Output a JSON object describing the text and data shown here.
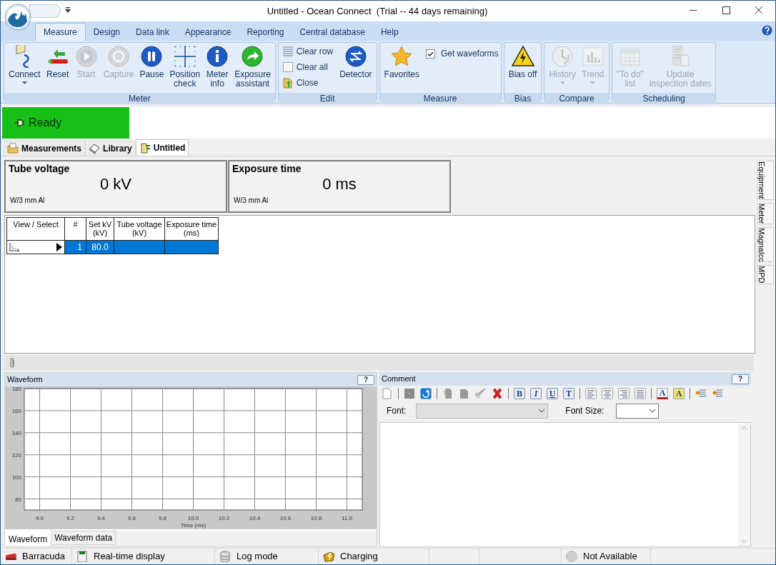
{
  "window": {
    "title": "Untitled - Ocean Connect  (Trial -- 44 days remaining)"
  },
  "ribbon_tabs": [
    {
      "label": "Measure",
      "selected": true
    },
    {
      "label": "Design",
      "selected": false
    },
    {
      "label": "Data link",
      "selected": false
    },
    {
      "label": "Appearance",
      "selected": false
    },
    {
      "label": "Reporting",
      "selected": false
    },
    {
      "label": "Central database",
      "selected": false
    },
    {
      "label": "Help",
      "selected": false
    }
  ],
  "ribbon_groups": [
    {
      "label": "Meter",
      "items": [
        {
          "kind": "large",
          "label": "Connect",
          "disabled": false,
          "dropdown": true
        },
        {
          "kind": "large",
          "label": "Reset",
          "disabled": false,
          "dropdown": false
        },
        {
          "kind": "large",
          "label": "Start",
          "disabled": true,
          "dropdown": false
        },
        {
          "kind": "large",
          "label": "Capture",
          "disabled": true,
          "dropdown": false
        },
        {
          "kind": "large",
          "label": "Pause",
          "disabled": false,
          "dropdown": false
        },
        {
          "kind": "large",
          "label": "Position\ncheck",
          "disabled": false,
          "dropdown": false
        },
        {
          "kind": "large",
          "label": "Meter\ninfo",
          "disabled": false,
          "dropdown": false
        },
        {
          "kind": "large",
          "label": "Exposure\nassistant",
          "disabled": false,
          "dropdown": false
        }
      ]
    },
    {
      "label": "Edit",
      "items": [
        {
          "kind": "small",
          "label": "Clear row",
          "disabled": false
        },
        {
          "kind": "small",
          "label": "Clear all",
          "disabled": false
        },
        {
          "kind": "small",
          "label": "Close",
          "disabled": false
        },
        {
          "kind": "large",
          "label": "Detector",
          "disabled": false,
          "dropdown": false
        }
      ]
    },
    {
      "label": "Measure",
      "items": [
        {
          "kind": "large",
          "label": "Favorites",
          "disabled": false,
          "dropdown": false
        },
        {
          "kind": "check",
          "label": "Get waveforms",
          "checked": true
        }
      ]
    },
    {
      "label": "Bias",
      "items": [
        {
          "kind": "large",
          "label": "Bias off",
          "disabled": false,
          "dropdown": false
        }
      ]
    },
    {
      "label": "Compare",
      "items": [
        {
          "kind": "large",
          "label": "History",
          "disabled": true,
          "dropdown": true
        },
        {
          "kind": "large",
          "label": "Trend",
          "disabled": true,
          "dropdown": true
        }
      ]
    },
    {
      "label": "Scheduling",
      "items": [
        {
          "kind": "large",
          "label": "\"To do\"\nlist",
          "disabled": true,
          "dropdown": false
        },
        {
          "kind": "large",
          "label": "Update\ninspection dates",
          "disabled": true,
          "dropdown": false
        }
      ]
    }
  ],
  "status": {
    "label": "Ready"
  },
  "doc_tabs": [
    {
      "label": "Measurements",
      "selected": false
    },
    {
      "label": "Library",
      "selected": false
    },
    {
      "label": "Untitled",
      "selected": true
    }
  ],
  "meter_cards": [
    {
      "title": "Tube voltage",
      "value": "0 kV",
      "note": "W/3 mm Al"
    },
    {
      "title": "Exposure time",
      "value": "0 ms",
      "note": "W/3 mm Al"
    }
  ],
  "table": {
    "columns": [
      "View / Select",
      "#",
      "Set kV\n(kV)",
      "Tube voltage\n(kV)",
      "Exposure time\n(ms)"
    ],
    "rows": [
      {
        "selected": true,
        "number": "1",
        "set_kv": "80.0"
      }
    ]
  },
  "side_tabs": [
    "Equipment",
    "Meter",
    "MagnaIcc",
    "MPD"
  ],
  "waveform": {
    "title": "Waveform",
    "help": "?",
    "chart_data": {
      "type": "line",
      "xlabel": "Time (ms)",
      "xlim": [
        8.9,
        11.1
      ],
      "ylim": [
        70,
        180
      ],
      "xticks": [
        {
          "value": 9,
          "label": "9.0"
        },
        9.2,
        9.4,
        9.6,
        9.8,
        {
          "value": 10,
          "label": "10.0"
        },
        10.2,
        10.4,
        10.6,
        10.8,
        {
          "value": 11,
          "label": "11.0"
        }
      ],
      "yticks": [
        80,
        100,
        120,
        140,
        160,
        180
      ],
      "grid": true
    },
    "tabs": [
      {
        "label": "Waveform",
        "selected": true
      },
      {
        "label": "Waveform data",
        "selected": false
      }
    ]
  },
  "comment": {
    "title": "Comment",
    "help": "?",
    "toolbar": [
      {
        "kind": "new"
      },
      {
        "kind": "sep"
      },
      {
        "kind": "save"
      },
      {
        "kind": "redo"
      },
      {
        "kind": "sep"
      },
      {
        "kind": "copy"
      },
      {
        "kind": "paste"
      },
      {
        "kind": "cut"
      },
      {
        "kind": "delete"
      },
      {
        "kind": "sep"
      },
      {
        "kind": "letter",
        "label": "B"
      },
      {
        "kind": "letter",
        "label": "I"
      },
      {
        "kind": "letter",
        "label": "U"
      },
      {
        "kind": "letter",
        "label": "T"
      },
      {
        "kind": "sep"
      },
      {
        "kind": "align-left"
      },
      {
        "kind": "align-center"
      },
      {
        "kind": "align-right"
      },
      {
        "kind": "justify"
      },
      {
        "kind": "sep"
      },
      {
        "kind": "color-letter",
        "label": "A"
      },
      {
        "kind": "highlight-letter",
        "label": "A"
      },
      {
        "kind": "sep"
      },
      {
        "kind": "indent"
      },
      {
        "kind": "outdent"
      }
    ],
    "font_label": "Font:",
    "font_disabled": true,
    "size_label": "Font Size:"
  },
  "status_bar": [
    {
      "kind": "device",
      "label": "Barracuda"
    },
    {
      "kind": "display",
      "label": "Real-time display"
    },
    {
      "kind": "log",
      "label": "Log mode"
    },
    {
      "kind": "charging",
      "label": "Charging"
    },
    {
      "kind": "empty"
    },
    {
      "kind": "empty"
    },
    {
      "kind": "availability",
      "label": "Not Available"
    }
  ]
}
